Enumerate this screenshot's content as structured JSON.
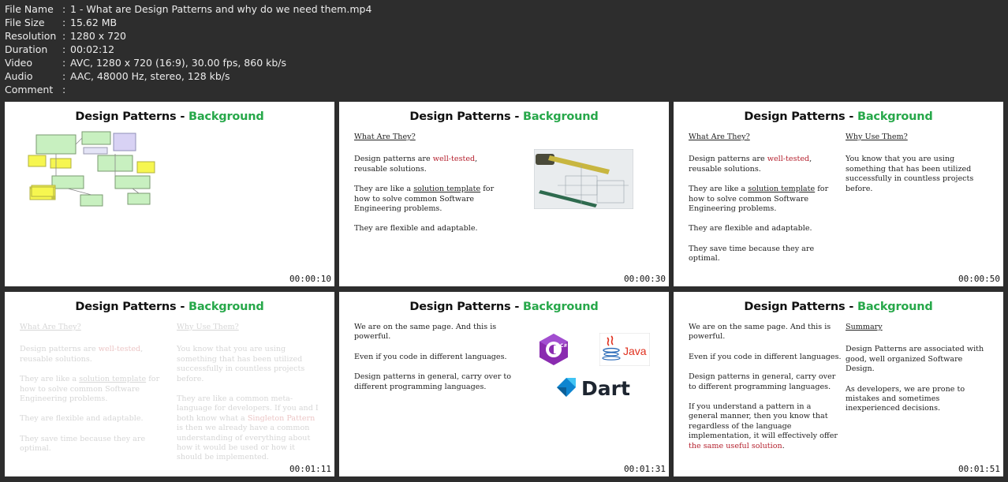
{
  "meta": {
    "rows": [
      {
        "key": "File Name",
        "value": "1 - What are Design Patterns and why do we need them.mp4"
      },
      {
        "key": "File Size",
        "value": "15.62 MB"
      },
      {
        "key": "Resolution",
        "value": "1280 x 720"
      },
      {
        "key": "Duration",
        "value": "00:02:12"
      },
      {
        "key": "Video",
        "value": "AVC, 1280 x 720 (16:9), 30.00 fps, 860 kb/s"
      },
      {
        "key": "Audio",
        "value": "AAC, 48000 Hz, stereo, 128 kb/s"
      },
      {
        "key": "Comment",
        "value": ""
      }
    ],
    "separator": ":"
  },
  "slide_title": {
    "main": "Design Patterns - ",
    "highlight": "Background"
  },
  "colors": {
    "accent": "#27a84a",
    "emphasis": "#b5222f",
    "background": "#2d2d2d"
  },
  "thumbs": [
    {
      "timestamp": "00:00:10"
    },
    {
      "timestamp": "00:00:30"
    },
    {
      "timestamp": "00:00:50"
    },
    {
      "timestamp": "00:01:11"
    },
    {
      "timestamp": "00:01:31"
    },
    {
      "timestamp": "00:01:51"
    }
  ],
  "what": {
    "heading": "What Are They?",
    "p1_a": "Design patterns are ",
    "p1_red": "well-tested",
    "p1_b": ", reusable solutions.",
    "p2_a": "They are like a ",
    "p2_u": "solution template",
    "p2_b": " for how to solve common Software Engineering problems.",
    "p3": "They are flexible and adaptable.",
    "p4": "They save time because they are optimal."
  },
  "why": {
    "heading": "Why Use Them?",
    "p1": "You know that you are using something that has been utilized successfully in countless projects before.",
    "p2_a": "They are like a common meta-language for developers. If you and I both know what a ",
    "p2_red": "Singleton Pattern",
    "p2_b": " is then we already have a common understanding of everything about how it would be used or how it should be implemented."
  },
  "langs": {
    "p1": "We are on the same page. And this is powerful.",
    "p2": "Even if you code in different languages.",
    "p3": "Design patterns in general, carry over to different programming languages.",
    "p4_a": "If you understand a pattern in a general manner, then you know that regardless of the language implementation, it will effectively offer ",
    "p4_red": "the same useful solution",
    "p4_b": ".",
    "csharp": "C#",
    "java": "Java",
    "dart": "Dart"
  },
  "summary": {
    "heading": "Summary",
    "p1": "Design Patterns are associated with good, well organized Software Design.",
    "p2": "As developers, we are prone to mistakes and sometimes inexperienced decisions."
  }
}
